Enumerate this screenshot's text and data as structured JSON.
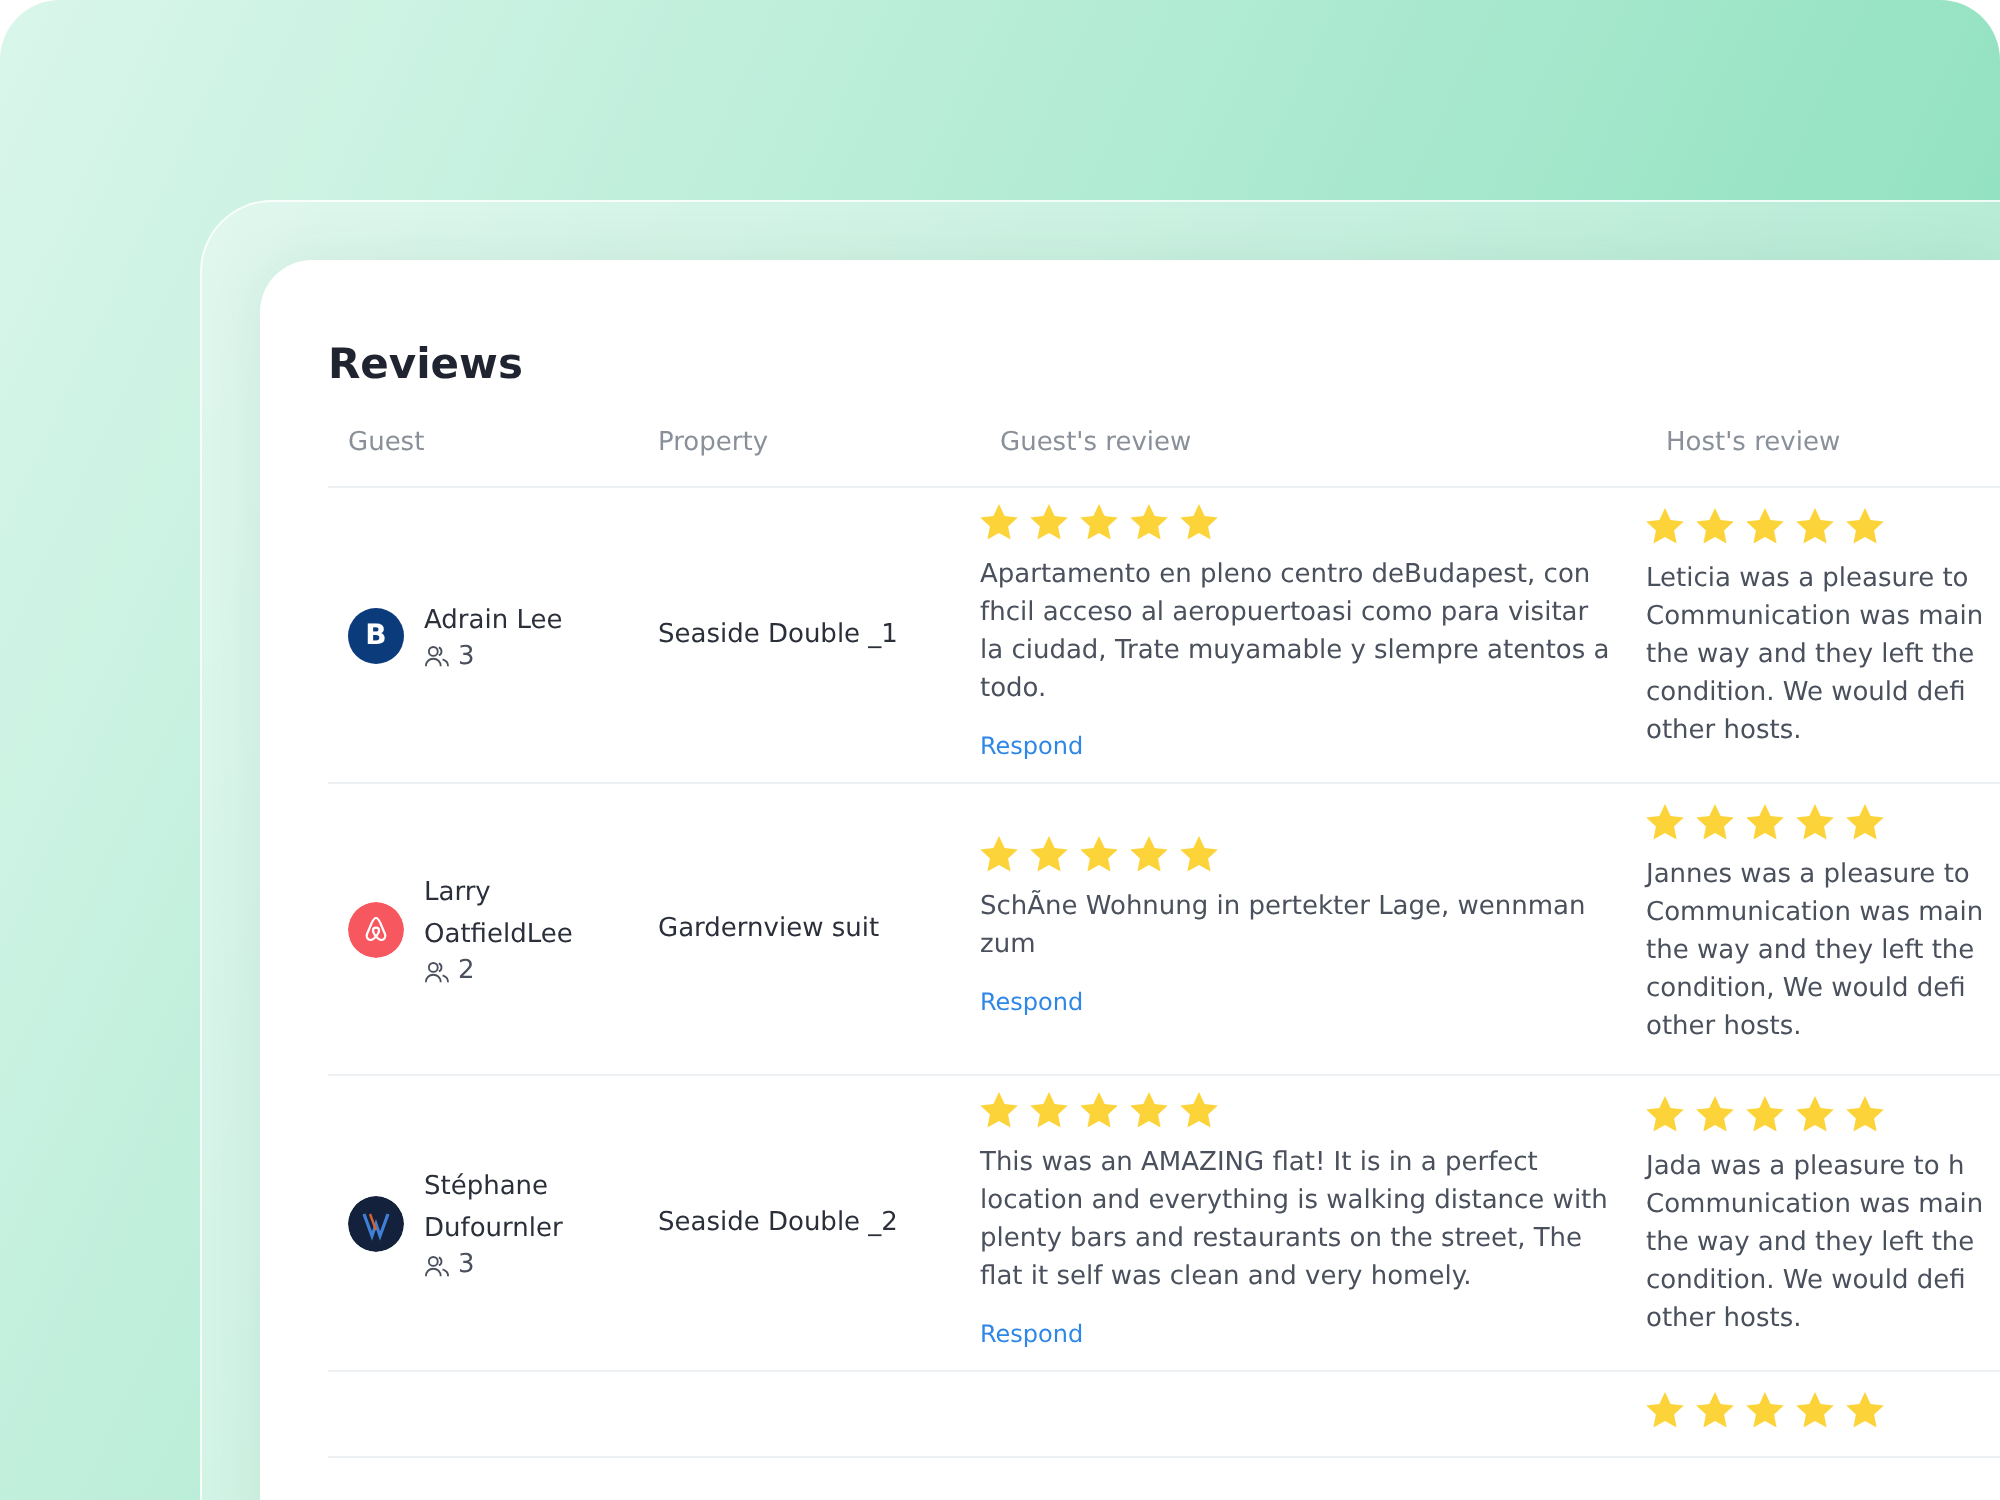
{
  "title": "Reviews",
  "columns": [
    "Guest",
    "Property",
    "Guest's review",
    "Host's review"
  ],
  "rows": [
    {
      "guest": {
        "name": "Adrain Lee",
        "avatar": {
          "kind": "booking",
          "letter": "B"
        },
        "guests": "3"
      },
      "property": "Seaside Double _1",
      "guest_review": {
        "stars": 5,
        "text": "Apartamento en pleno centro deBudapest, con fhcil acceso al aeropuertoasi como para visitar la ciudad, Trate muyamable y slempre atentos a todo.",
        "action": "Respond"
      },
      "host_review": {
        "stars": 5,
        "lines": [
          "Leticia was a pleasure to",
          "Communication was main",
          "the way and they left the",
          "condition. We would defi",
          "other hosts."
        ]
      }
    },
    {
      "guest": {
        "name": "Larry OatfieldLee",
        "avatar": {
          "kind": "airbnb"
        },
        "guests": "2"
      },
      "property": "Gardernview suit",
      "guest_review": {
        "stars": 5,
        "text": "SchÃne Wohnung in pertekter Lage, wennman zum",
        "action": "Respond"
      },
      "host_review": {
        "stars": 5,
        "lines": [
          "Jannes was a pleasure to",
          "Communication was main",
          "the way and they left the",
          "condition, We would defi",
          "other hosts."
        ]
      }
    },
    {
      "guest": {
        "name": "Stéphane Dufournler",
        "avatar": {
          "kind": "monogram"
        },
        "guests": "3"
      },
      "property": "Seaside Double _2",
      "guest_review": {
        "stars": 5,
        "text": "This was an AMAZING flat! It is in a perfect location and everything is walking distance with plenty bars and restaurants on the street, The flat it self was clean and very homely.",
        "action": "Respond"
      },
      "host_review": {
        "stars": 5,
        "lines": [
          "Jada was a pleasure to h",
          "Communication was main",
          "the way and they left the",
          "condition. We would defi",
          "other hosts."
        ]
      }
    },
    {
      "host_review": {
        "stars": 5
      }
    }
  ]
}
